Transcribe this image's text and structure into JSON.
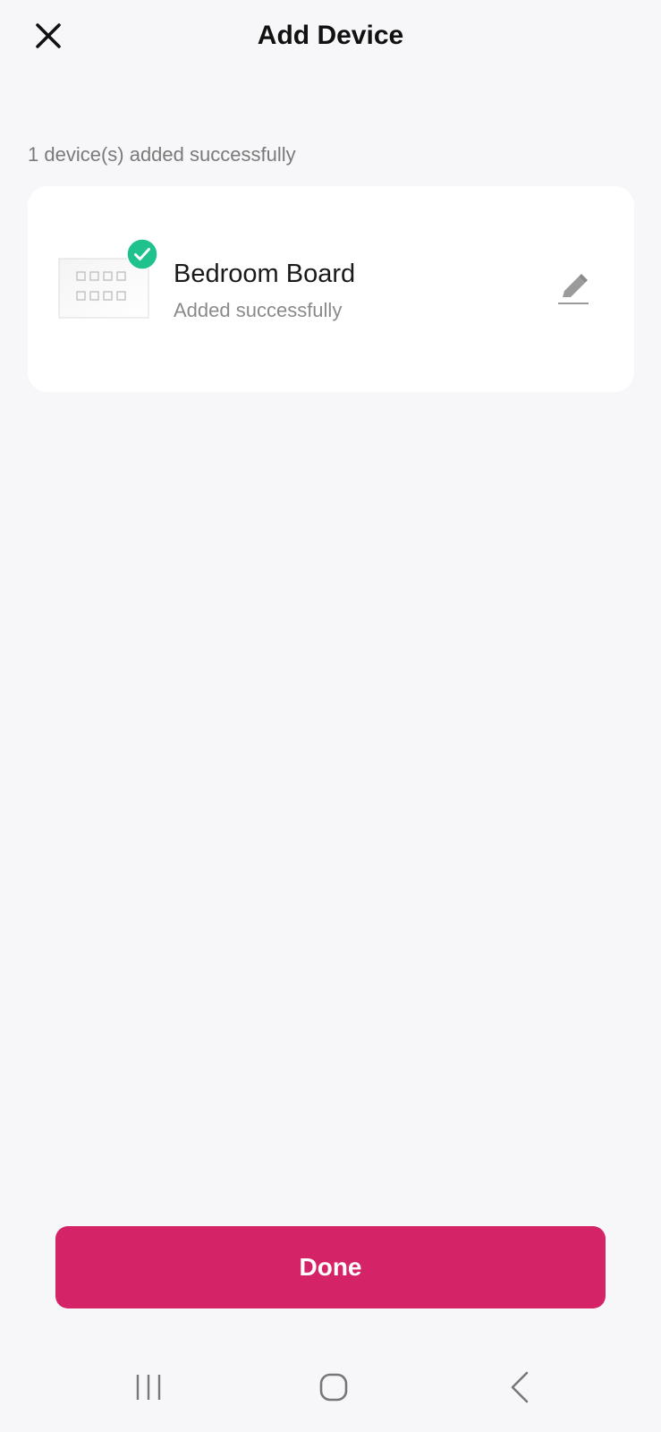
{
  "header": {
    "title": "Add Device",
    "close_icon": "close-icon"
  },
  "summary": {
    "caption": "1 device(s) added successfully"
  },
  "devices": [
    {
      "name": "Bedroom Board",
      "status": "Added successfully",
      "thumbnail_icon": "switch-board-icon",
      "badge_icon": "check-circle-icon",
      "action_icon": "pencil-icon"
    }
  ],
  "footer": {
    "done_label": "Done"
  },
  "navigation": {
    "recents_icon": "recents-icon",
    "home_icon": "home-icon",
    "back_icon": "back-icon"
  },
  "colors": {
    "background": "#f7f7f9",
    "card": "#ffffff",
    "accent": "#d42367",
    "success": "#1fc18d"
  }
}
